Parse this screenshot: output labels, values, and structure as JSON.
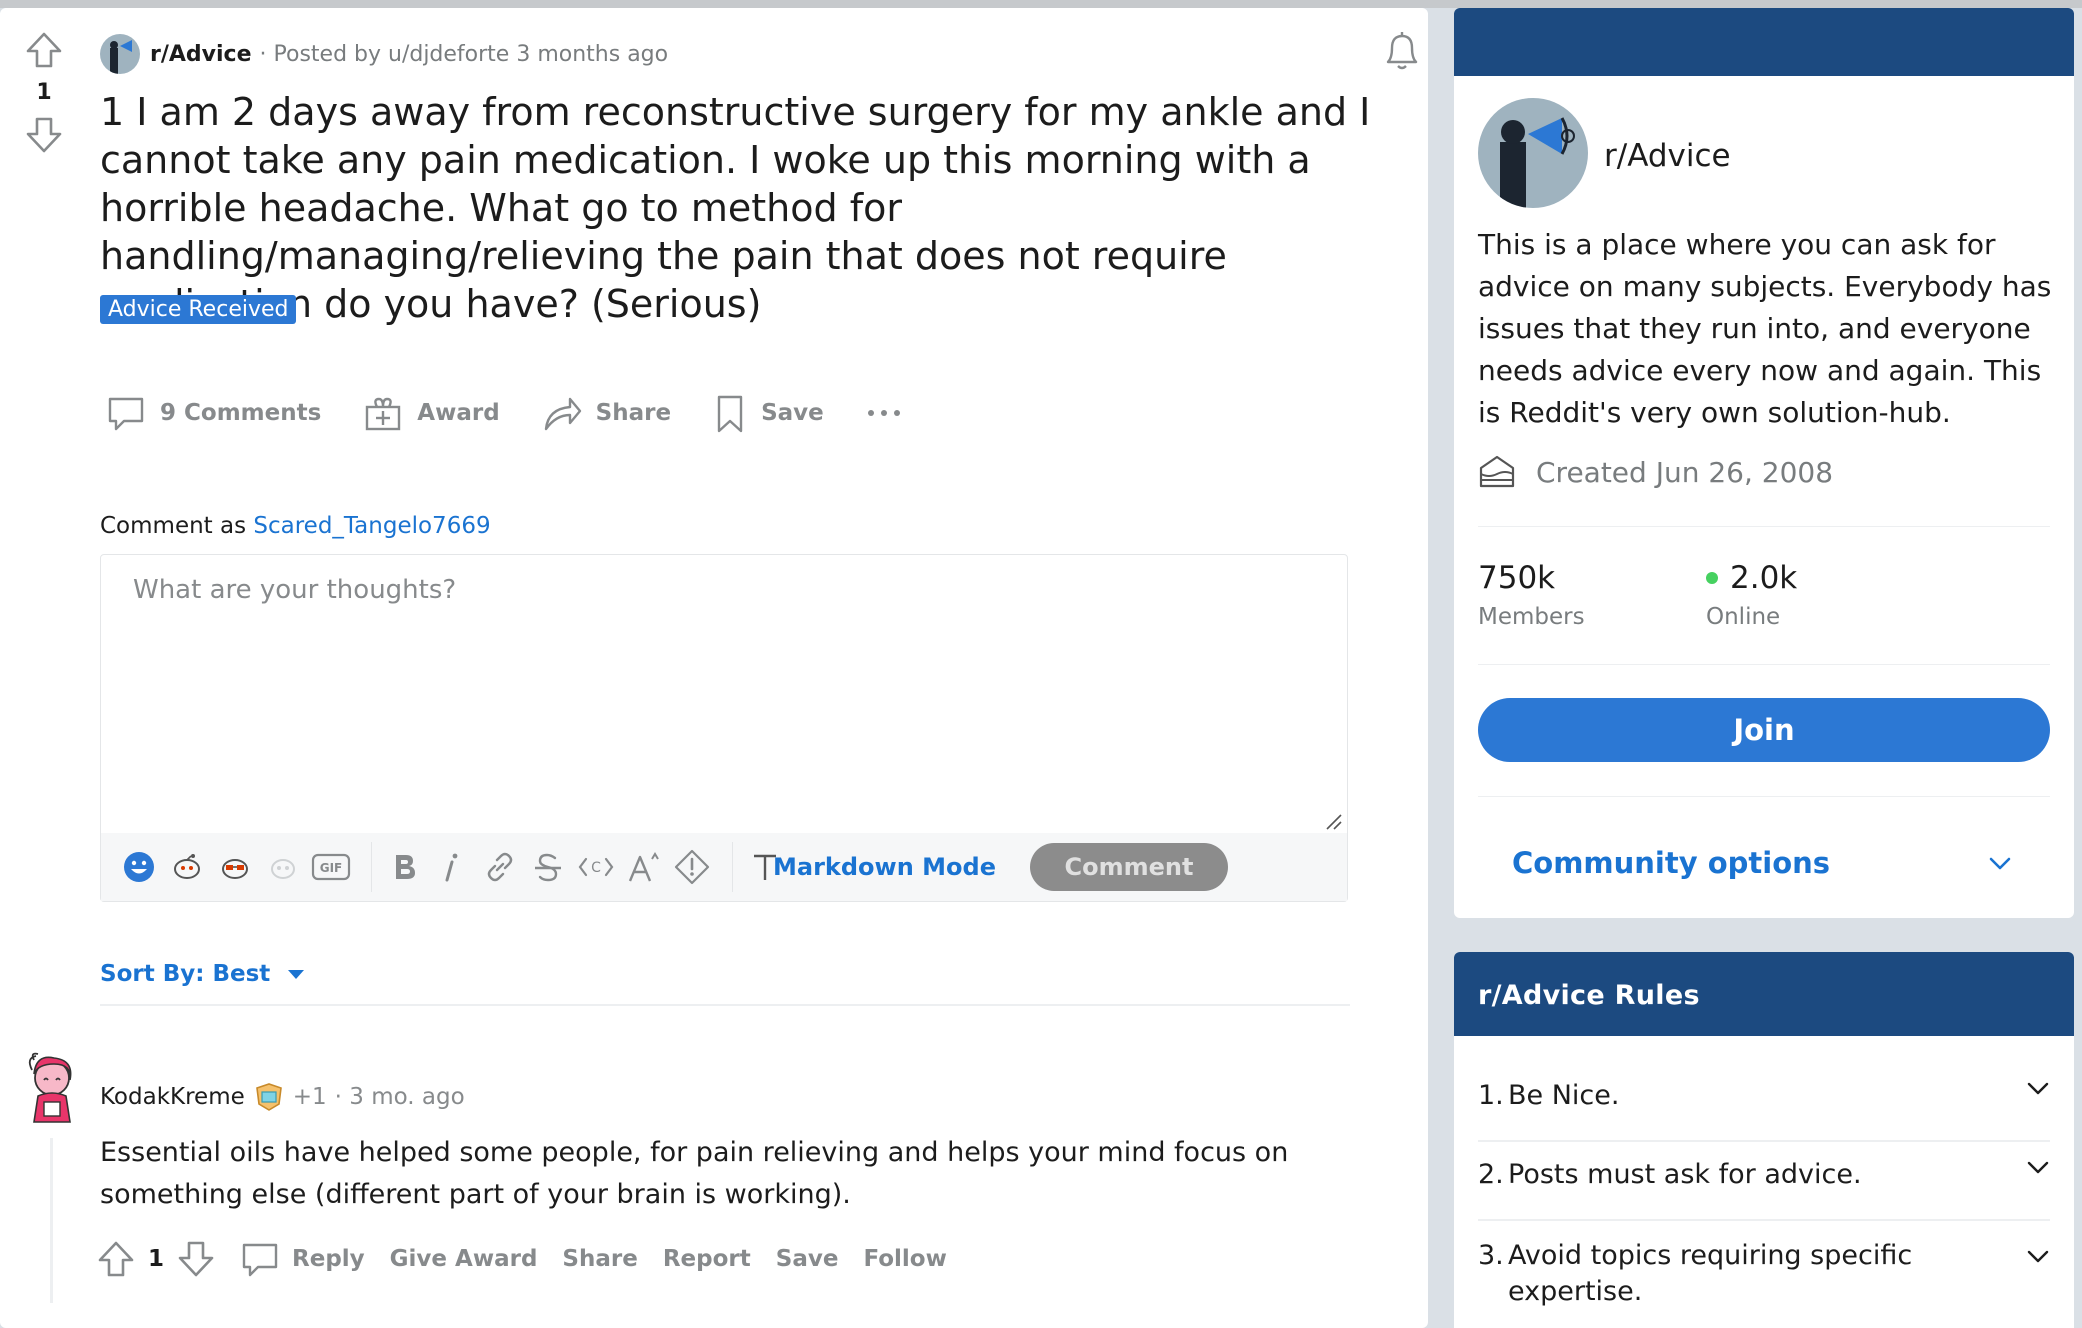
{
  "post": {
    "vote_count": "1",
    "subreddit": "r/Advice",
    "posted_by": "· Posted by u/djdeforte 3 months ago",
    "title": "1 I am 2 days away from reconstructive surgery for my ankle and I cannot take any pain medication. I woke up this morning with a horrible headache. What go to method for handling/managing/relieving the pain that does not require medication do you have? (Serious)",
    "flair": "Advice Received",
    "actions": {
      "comments": "9 Comments",
      "award": "Award",
      "share": "Share",
      "save": "Save"
    }
  },
  "composer": {
    "comment_as_label": "Comment as",
    "username": "Scared_Tangelo7669",
    "placeholder": "What are your thoughts?",
    "markdown_mode": "Markdown Mode",
    "comment_button": "Comment",
    "toolbar_icons": [
      "emoji-icon",
      "snoo-icon",
      "snoo-glasses-icon",
      "snoo-faded-icon",
      "gif-icon",
      "bold-icon",
      "italic-icon",
      "link-icon",
      "strikethrough-icon",
      "inline-code-icon",
      "superscript-icon",
      "spoiler-icon",
      "heading-icon"
    ]
  },
  "sort": {
    "label": "Sort By: Best"
  },
  "comment": {
    "author": "KodakKreme",
    "plus": "+1",
    "time": "· 3 mo. ago",
    "body": "Essential oils have helped some people, for pain relieving and helps your mind focus on something else (different part of your brain is working).",
    "votes": "1",
    "actions": {
      "reply": "Reply",
      "give_award": "Give Award",
      "share": "Share",
      "report": "Report",
      "save": "Save",
      "follow": "Follow"
    }
  },
  "sidebar": {
    "name": "r/Advice",
    "description": "This is a place where you can ask for advice on many subjects. Everybody has issues that they run into, and everyone needs advice every now and again. This is Reddit's very own solution-hub.",
    "created": "Created Jun 26, 2008",
    "members_count": "750k",
    "members_label": "Members",
    "online_count": "2.0k",
    "online_label": "Online",
    "join": "Join",
    "community_options": "Community options"
  },
  "rules": {
    "title": "r/Advice Rules",
    "items": [
      {
        "num": "1.",
        "text": "Be Nice."
      },
      {
        "num": "2.",
        "text": "Posts must ask for advice."
      },
      {
        "num": "3.",
        "text": "Avoid topics requiring specific expertise."
      }
    ]
  },
  "colors": {
    "accent_blue": "#2c78d4",
    "header_navy": "#1c4a80",
    "online_green": "#46d160"
  }
}
